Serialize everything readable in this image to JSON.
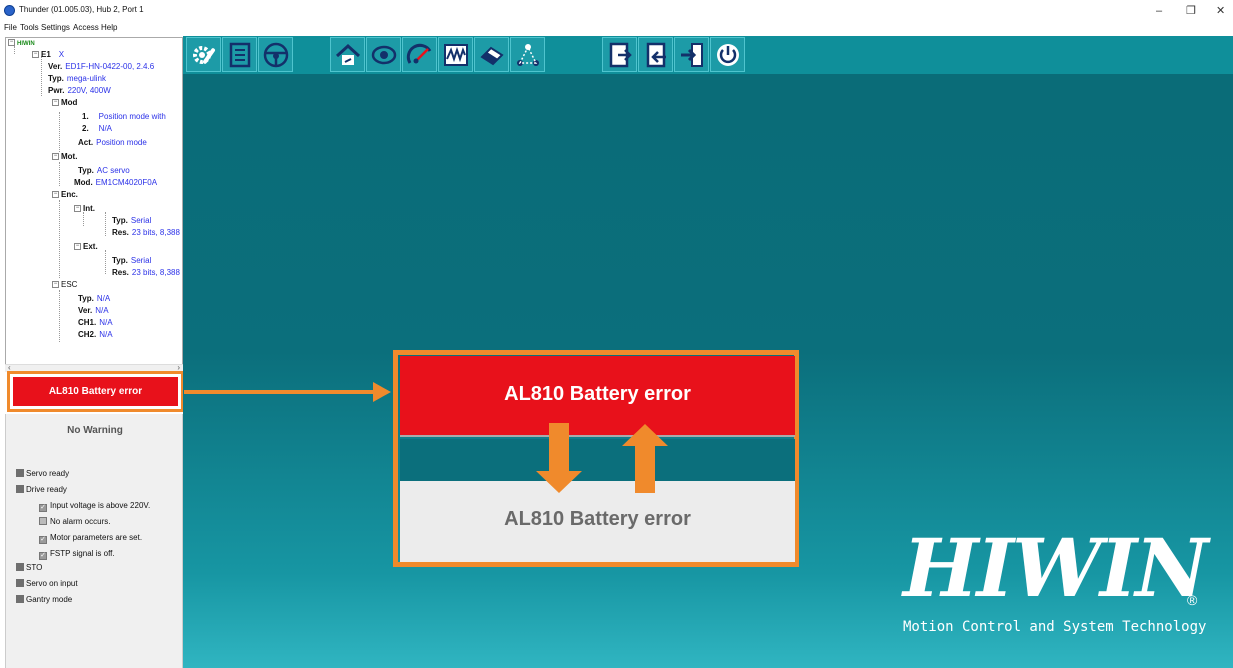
{
  "window": {
    "title": "Thunder (01.005.03), Hub 2, Port 1",
    "min_glyph": "–",
    "max_glyph": "❐",
    "close_glyph": "✕"
  },
  "menu": [
    "File",
    "Tools",
    "Settings",
    "Access",
    "Help"
  ],
  "tree": {
    "root": "HIWIN",
    "axis": {
      "label": "E1",
      "value": "X"
    },
    "ver": {
      "label": "Ver.",
      "value": "ED1F-HN-0422-00, 2.4.6"
    },
    "typ": {
      "label": "Typ.",
      "value": "mega-ulink"
    },
    "pwr": {
      "label": "Pwr.",
      "value": "220V, 400W"
    },
    "mod": {
      "label": "Mod",
      "m1": {
        "label": "1.",
        "value": "Position mode with"
      },
      "m2": {
        "label": "2.",
        "value": "N/A"
      },
      "act": {
        "label": "Act.",
        "value": "Position mode"
      }
    },
    "mot": {
      "label": "Mot.",
      "typ": {
        "label": "Typ.",
        "value": "AC servo"
      },
      "mod": {
        "label": "Mod.",
        "value": "EM1CM4020F0A"
      }
    },
    "enc": {
      "label": "Enc.",
      "int": {
        "label": "Int.",
        "typ": {
          "label": "Typ.",
          "value": "Serial"
        },
        "res": {
          "label": "Res.",
          "value": "23 bits, 8,388"
        }
      },
      "ext": {
        "label": "Ext.",
        "typ": {
          "label": "Typ.",
          "value": "Serial"
        },
        "res": {
          "label": "Res.",
          "value": "23 bits, 8,388"
        }
      }
    },
    "esc": {
      "label": "ESC",
      "typ": {
        "label": "Typ.",
        "value": "N/A"
      },
      "ver": {
        "label": "Ver.",
        "value": "N/A"
      },
      "ch1": {
        "label": "CH1.",
        "value": "N/A"
      },
      "ch2": {
        "label": "CH2.",
        "value": "N/A"
      }
    }
  },
  "alarm": {
    "text": "AL810  Battery error",
    "color": "#e8111b"
  },
  "warning": {
    "text": "No Warning"
  },
  "status": {
    "servo_ready": "Servo ready",
    "drive_ready": "Drive ready",
    "cond_voltage": "Input voltage is above 220V.",
    "cond_alarm": "No alarm occurs.",
    "cond_motor": "Motor parameters are set.",
    "cond_fstp": "FSTP signal is off.",
    "sto": "STO",
    "servo_on": "Servo on input",
    "gantry": "Gantry mode"
  },
  "toolbar": [
    {
      "icon": "configuration-icon"
    },
    {
      "icon": "document-list-icon"
    },
    {
      "icon": "steering-wheel-icon"
    },
    {
      "icon": "home-icon"
    },
    {
      "icon": "eye-icon"
    },
    {
      "icon": "gauge-icon"
    },
    {
      "icon": "waveform-icon"
    },
    {
      "icon": "eraser-icon"
    },
    {
      "icon": "network-icon"
    },
    {
      "icon": "export-icon"
    },
    {
      "icon": "import-icon"
    },
    {
      "icon": "enter-icon"
    },
    {
      "icon": "power-icon"
    }
  ],
  "callout": {
    "top_text": "AL810  Battery error",
    "bottom_text": "AL810  Battery error",
    "accent": "#f08a2c"
  },
  "logo": {
    "name": "HIWIN",
    "reg": "®",
    "tagline": "Motion Control and System Technology"
  }
}
